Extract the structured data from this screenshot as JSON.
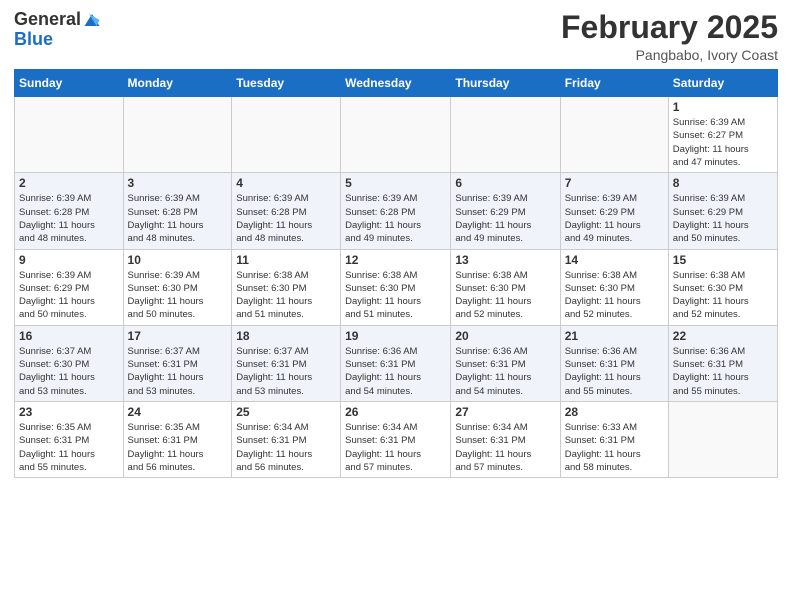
{
  "header": {
    "logo_general": "General",
    "logo_blue": "Blue",
    "month": "February 2025",
    "location": "Pangbabo, Ivory Coast"
  },
  "weekdays": [
    "Sunday",
    "Monday",
    "Tuesday",
    "Wednesday",
    "Thursday",
    "Friday",
    "Saturday"
  ],
  "weeks": [
    [
      {
        "day": "",
        "info": ""
      },
      {
        "day": "",
        "info": ""
      },
      {
        "day": "",
        "info": ""
      },
      {
        "day": "",
        "info": ""
      },
      {
        "day": "",
        "info": ""
      },
      {
        "day": "",
        "info": ""
      },
      {
        "day": "1",
        "info": "Sunrise: 6:39 AM\nSunset: 6:27 PM\nDaylight: 11 hours\nand 47 minutes."
      }
    ],
    [
      {
        "day": "2",
        "info": "Sunrise: 6:39 AM\nSunset: 6:28 PM\nDaylight: 11 hours\nand 48 minutes."
      },
      {
        "day": "3",
        "info": "Sunrise: 6:39 AM\nSunset: 6:28 PM\nDaylight: 11 hours\nand 48 minutes."
      },
      {
        "day": "4",
        "info": "Sunrise: 6:39 AM\nSunset: 6:28 PM\nDaylight: 11 hours\nand 48 minutes."
      },
      {
        "day": "5",
        "info": "Sunrise: 6:39 AM\nSunset: 6:28 PM\nDaylight: 11 hours\nand 49 minutes."
      },
      {
        "day": "6",
        "info": "Sunrise: 6:39 AM\nSunset: 6:29 PM\nDaylight: 11 hours\nand 49 minutes."
      },
      {
        "day": "7",
        "info": "Sunrise: 6:39 AM\nSunset: 6:29 PM\nDaylight: 11 hours\nand 49 minutes."
      },
      {
        "day": "8",
        "info": "Sunrise: 6:39 AM\nSunset: 6:29 PM\nDaylight: 11 hours\nand 50 minutes."
      }
    ],
    [
      {
        "day": "9",
        "info": "Sunrise: 6:39 AM\nSunset: 6:29 PM\nDaylight: 11 hours\nand 50 minutes."
      },
      {
        "day": "10",
        "info": "Sunrise: 6:39 AM\nSunset: 6:30 PM\nDaylight: 11 hours\nand 50 minutes."
      },
      {
        "day": "11",
        "info": "Sunrise: 6:38 AM\nSunset: 6:30 PM\nDaylight: 11 hours\nand 51 minutes."
      },
      {
        "day": "12",
        "info": "Sunrise: 6:38 AM\nSunset: 6:30 PM\nDaylight: 11 hours\nand 51 minutes."
      },
      {
        "day": "13",
        "info": "Sunrise: 6:38 AM\nSunset: 6:30 PM\nDaylight: 11 hours\nand 52 minutes."
      },
      {
        "day": "14",
        "info": "Sunrise: 6:38 AM\nSunset: 6:30 PM\nDaylight: 11 hours\nand 52 minutes."
      },
      {
        "day": "15",
        "info": "Sunrise: 6:38 AM\nSunset: 6:30 PM\nDaylight: 11 hours\nand 52 minutes."
      }
    ],
    [
      {
        "day": "16",
        "info": "Sunrise: 6:37 AM\nSunset: 6:30 PM\nDaylight: 11 hours\nand 53 minutes."
      },
      {
        "day": "17",
        "info": "Sunrise: 6:37 AM\nSunset: 6:31 PM\nDaylight: 11 hours\nand 53 minutes."
      },
      {
        "day": "18",
        "info": "Sunrise: 6:37 AM\nSunset: 6:31 PM\nDaylight: 11 hours\nand 53 minutes."
      },
      {
        "day": "19",
        "info": "Sunrise: 6:36 AM\nSunset: 6:31 PM\nDaylight: 11 hours\nand 54 minutes."
      },
      {
        "day": "20",
        "info": "Sunrise: 6:36 AM\nSunset: 6:31 PM\nDaylight: 11 hours\nand 54 minutes."
      },
      {
        "day": "21",
        "info": "Sunrise: 6:36 AM\nSunset: 6:31 PM\nDaylight: 11 hours\nand 55 minutes."
      },
      {
        "day": "22",
        "info": "Sunrise: 6:36 AM\nSunset: 6:31 PM\nDaylight: 11 hours\nand 55 minutes."
      }
    ],
    [
      {
        "day": "23",
        "info": "Sunrise: 6:35 AM\nSunset: 6:31 PM\nDaylight: 11 hours\nand 55 minutes."
      },
      {
        "day": "24",
        "info": "Sunrise: 6:35 AM\nSunset: 6:31 PM\nDaylight: 11 hours\nand 56 minutes."
      },
      {
        "day": "25",
        "info": "Sunrise: 6:34 AM\nSunset: 6:31 PM\nDaylight: 11 hours\nand 56 minutes."
      },
      {
        "day": "26",
        "info": "Sunrise: 6:34 AM\nSunset: 6:31 PM\nDaylight: 11 hours\nand 57 minutes."
      },
      {
        "day": "27",
        "info": "Sunrise: 6:34 AM\nSunset: 6:31 PM\nDaylight: 11 hours\nand 57 minutes."
      },
      {
        "day": "28",
        "info": "Sunrise: 6:33 AM\nSunset: 6:31 PM\nDaylight: 11 hours\nand 58 minutes."
      },
      {
        "day": "",
        "info": ""
      }
    ]
  ]
}
